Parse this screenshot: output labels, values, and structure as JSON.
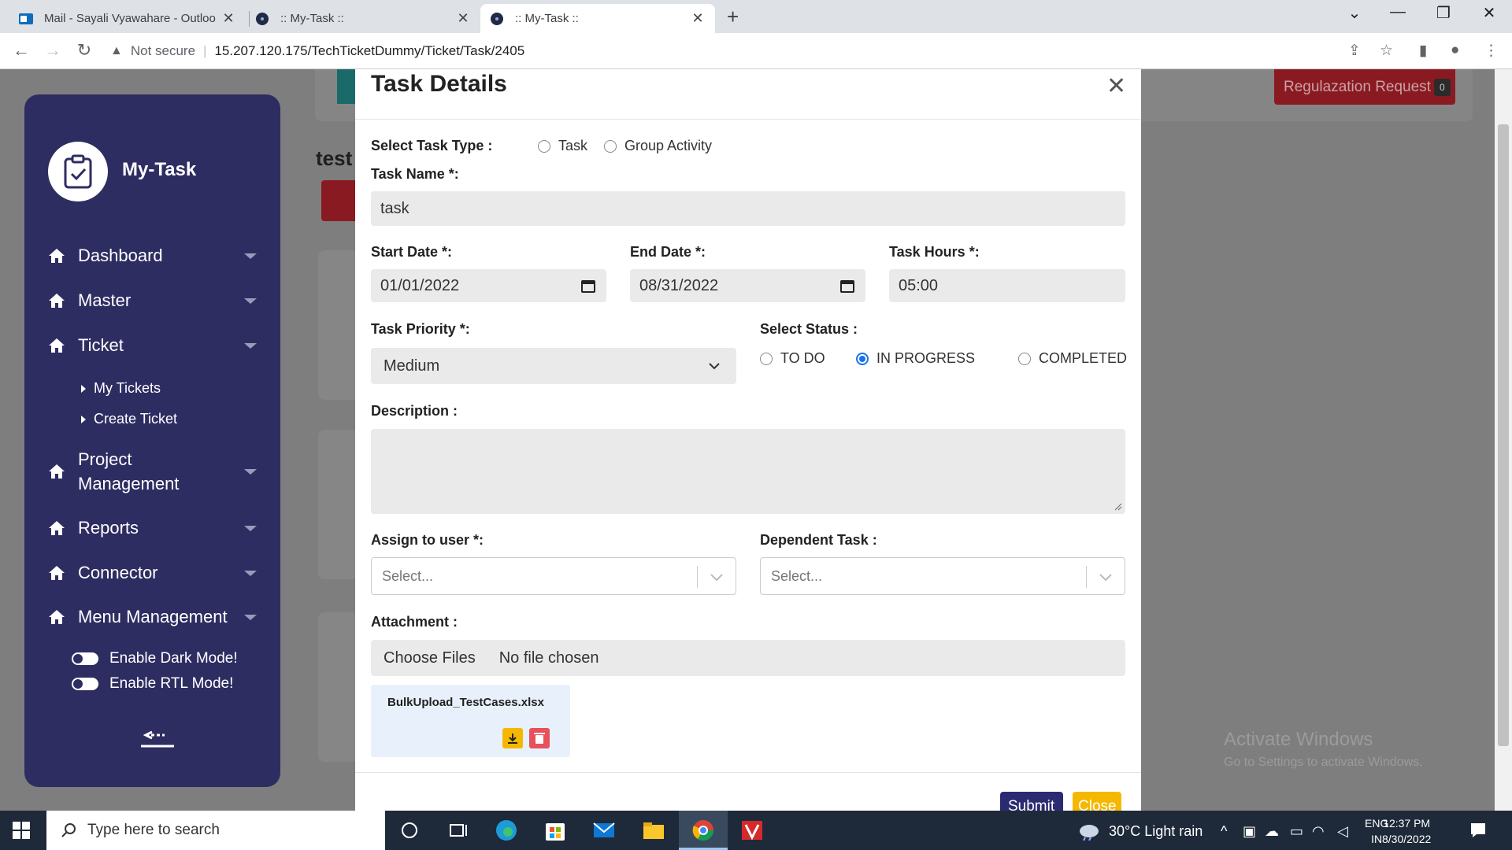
{
  "browser": {
    "tabs": [
      {
        "title": "Mail - Sayali Vyawahare - Outloo",
        "active": false
      },
      {
        "title": ":: My-Task ::",
        "active": false
      },
      {
        "title": ":: My-Task ::",
        "active": true
      }
    ],
    "security": "Not secure",
    "url": "15.207.120.175/TechTicketDummy/Ticket/Task/2405"
  },
  "sidebar": {
    "brand": "My-Task",
    "items": [
      {
        "label": "Dashboard"
      },
      {
        "label": "Master"
      },
      {
        "label": "Ticket"
      },
      {
        "label": "Project Management"
      },
      {
        "label": "Reports"
      },
      {
        "label": "Connector"
      },
      {
        "label": "Menu Management"
      }
    ],
    "ticket_sub": [
      "My Tickets",
      "Create Ticket"
    ],
    "toggles": [
      "Enable Dark Mode!",
      "Enable RTL Mode!"
    ]
  },
  "background": {
    "title": "test",
    "regularization_label": "Regulazation Request",
    "regularization_count": "0"
  },
  "modal": {
    "title": "Task Details",
    "task_type_label": "Select Task Type :",
    "task_type_options": [
      "Task",
      "Group Activity"
    ],
    "task_name_label": "Task Name *:",
    "task_name_value": "task",
    "start_date_label": "Start Date *:",
    "start_date_value": "01/01/2022",
    "end_date_label": "End Date *:",
    "end_date_value": "08/31/2022",
    "task_hours_label": "Task Hours *:",
    "task_hours_value": "05:00",
    "priority_label": "Task Priority *:",
    "priority_value": "Medium",
    "status_label": "Select Status :",
    "status_options": [
      "TO DO",
      "IN PROGRESS",
      "COMPLETED"
    ],
    "status_selected": "IN PROGRESS",
    "description_label": "Description :",
    "description_value": "",
    "assign_label": "Assign to user *:",
    "assign_placeholder": "Select...",
    "dependent_label": "Dependent Task :",
    "dependent_placeholder": "Select...",
    "attachment_label": "Attachment :",
    "choose_files": "Choose Files",
    "no_file": "No file chosen",
    "attached_file": "BulkUpload_TestCases.xlsx",
    "submit": "Submit",
    "close": "Close"
  },
  "watermark": {
    "line1": "Activate Windows",
    "line2": "Go to Settings to activate Windows."
  },
  "taskbar": {
    "search_placeholder": "Type here to search",
    "weather": "30°C  Light rain",
    "lang1": "ENG",
    "lang2": "IN",
    "time": "12:37 PM",
    "date": "8/30/2022"
  }
}
